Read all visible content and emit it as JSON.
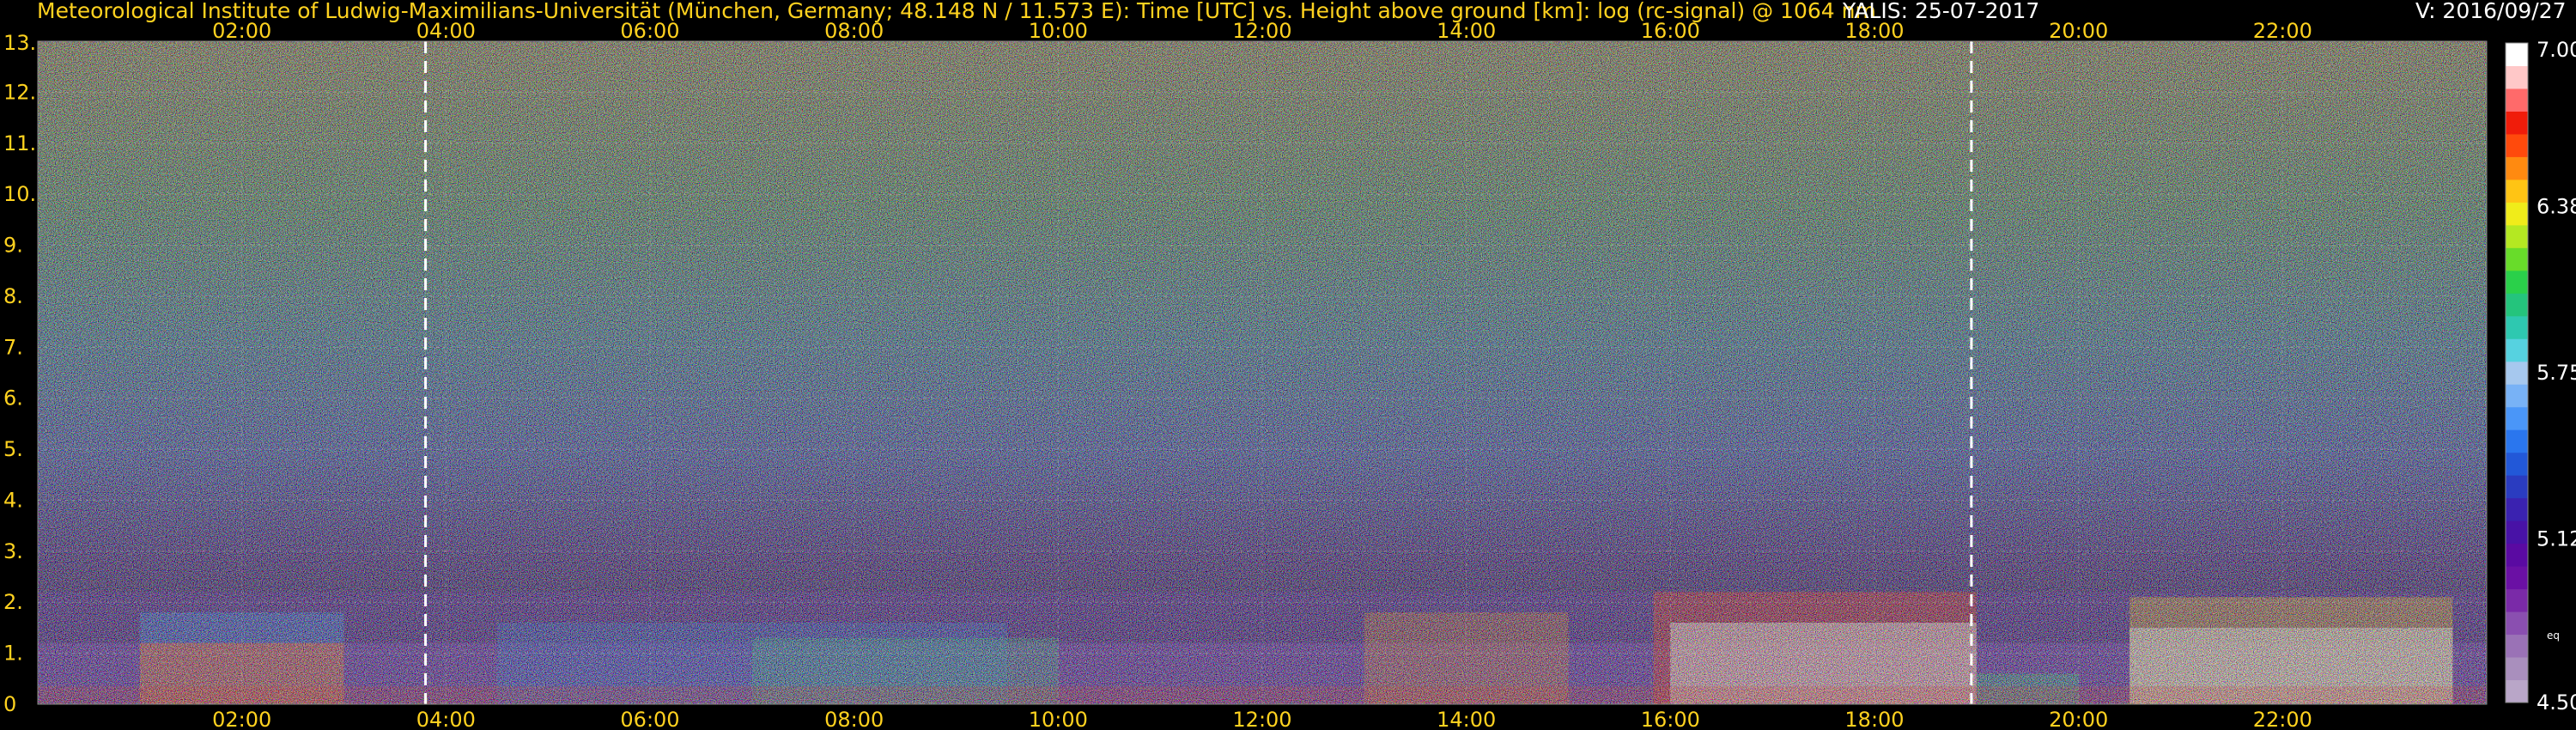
{
  "header": {
    "institute": "Meteorological Institute of Ludwig-Maximilians-Universität (München, Germany; 48.148 N / 11.573 E):",
    "plot_desc": "Time [UTC] vs. Height above ground [km]: log (rc-signal) @ 1064 nm",
    "station_date": "YALIS: 25-07-2017",
    "version": "V: 2016/09/27"
  },
  "colors": {
    "label_yellow": "#ffd21f",
    "background": "#000000",
    "marker_line": "#ffffff"
  },
  "chart_data": {
    "type": "heatmap",
    "xlabel": "Time [UTC]",
    "ylabel": "Height above ground [km]",
    "xlim": [
      "00:00",
      "24:00"
    ],
    "ylim": [
      0,
      13
    ],
    "x_ticks": [
      "02:00",
      "04:00",
      "06:00",
      "08:00",
      "10:00",
      "12:00",
      "14:00",
      "16:00",
      "18:00",
      "20:00",
      "22:00"
    ],
    "y_ticks": [
      "0",
      "1.",
      "2.",
      "3.",
      "4.",
      "5.",
      "6.",
      "7.",
      "8.",
      "9.",
      "10.",
      "11.",
      "12.",
      "13."
    ],
    "grid": true,
    "dashed_markers_utc": [
      "03:48",
      "18:57"
    ],
    "colorbar": {
      "range": [
        4.5,
        7.0
      ],
      "tick_labels": [
        "7.00",
        "6.38",
        "5.75",
        "5.12",
        "4.50"
      ],
      "unit_label": "eq",
      "colors": [
        "#b9a6c8",
        "#a98fbd",
        "#9a72b6",
        "#8a4fb0",
        "#7a2aa8",
        "#6a10a4",
        "#5a0aa2",
        "#4812a6",
        "#3a22b0",
        "#2a3cc0",
        "#2258d8",
        "#2a76ee",
        "#4a96f8",
        "#78b2f6",
        "#a6c8ee",
        "#56d2e0",
        "#2ec8b0",
        "#24c47c",
        "#2ad04a",
        "#68dc2a",
        "#b4e822",
        "#f0ec1a",
        "#ffc414",
        "#ff8a10",
        "#ff4a0c",
        "#f01c0a",
        "#ff6a6a",
        "#ffc8c8",
        "#ffffff"
      ]
    }
  }
}
